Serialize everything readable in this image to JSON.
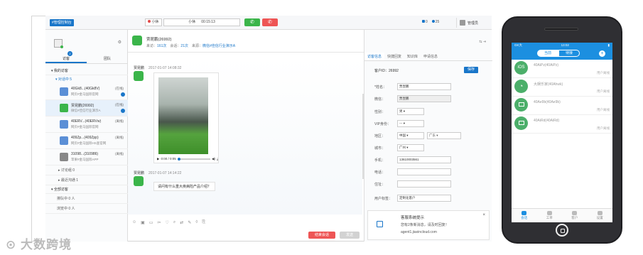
{
  "topbar": {
    "brand": "#管理控制台",
    "status": "小休",
    "status_text": "小休",
    "timer": "00:15:13",
    "msg_count": "0",
    "chat_count": "25",
    "user": "管理员"
  },
  "left": {
    "tabs": [
      {
        "label": "访客",
        "badge": "2"
      },
      {
        "label": "团队"
      }
    ],
    "my_visitors": "我的访客",
    "talking": "对话中 5",
    "visitors": [
      {
        "name": "40Gk8...(40Gk8V)",
        "source": "网页#金马国际官网",
        "status": "(在线)",
        "color": "#5b8fd6"
      },
      {
        "name": "贾昆鹏(26992)",
        "source": "微信#佳信行业演示A",
        "status": "(在线)",
        "color": "#3bb54a"
      },
      {
        "name": "40ERV...(40ERVw)",
        "source": "网页#金马国际官网",
        "status": "(离线)",
        "color": "#5b8fd6"
      },
      {
        "name": "409Zp...(409Zpp)",
        "source": "网页#金马国际HS查官网",
        "status": "(离线)",
        "color": "#5b8fd6"
      },
      {
        "name": "31098...(310986)",
        "source": "苹果#金马国际APP",
        "status": "(离线)",
        "color": "#888888"
      }
    ],
    "discussion": "讨论组 0",
    "recent": "最近沟通 1",
    "all_visitors": "全部访客",
    "queued": "排队中 0 人",
    "browsing": "浏览中 0 人"
  },
  "chat": {
    "name": "贾昆鹏(26992)",
    "visits_label": "来访：",
    "visits": "161次",
    "sessions_label": "会话：",
    "sessions": "21次",
    "source_label": "来源：",
    "source": "微信#佳信行业演示A",
    "m1_name": "贾昆鹏",
    "m1_time": "2017-01-07 14:08:32",
    "video_time": "0:00 / 0:05",
    "m2_name": "贾昆鹏",
    "m2_time": "2017-01-07 14:14:22",
    "m2_text": "请问有什么重大疾病险产品介绍？",
    "end_label": "结束会话",
    "send_label": "发送"
  },
  "right": {
    "tabs": [
      "访客信息",
      "快捷回复",
      "知识库",
      "申请信息"
    ],
    "id_label": "客户ID：",
    "id": "26992",
    "save": "保存",
    "fields": [
      {
        "label": "*姓名：",
        "value": "贾昆鹏"
      },
      {
        "label": "微信：",
        "value": "贾昆鹏"
      },
      {
        "label": "性别：",
        "value": "男"
      },
      {
        "label": "VIP身份：",
        "value": "---"
      },
      {
        "label": "地区：",
        "value": "中国",
        "value2": "广东"
      },
      {
        "label": "城市：",
        "value": "广州"
      },
      {
        "label": "手机：",
        "value": "13610003561"
      },
      {
        "label": "电话：",
        "value": ""
      },
      {
        "label": "住址：",
        "value": ""
      },
      {
        "label": "用户标签：",
        "value": "定制化客户"
      }
    ],
    "notice_title": "客服系统提示",
    "notice_msg": "您有2条新消息，请及时回复！",
    "notice_site": "agent1.jiaxincloud.com"
  },
  "watermark": "大数跨境",
  "phone": {
    "carrier": "GK大",
    "time": "13:02",
    "tab_on": "当前",
    "tab_off": "待接",
    "items": [
      {
        "name": "40AiPz(40AiPz)",
        "status": "用户离线",
        "icon": "iOS"
      },
      {
        "name": "大娱乐家(40Ahwk)",
        "status": "用户离线",
        "icon": "wechat"
      },
      {
        "name": "40Ae9b(40Ae9b)",
        "status": "用户离线",
        "icon": "web"
      },
      {
        "name": "40AiRd(40AiRd)",
        "status": "用户离线",
        "icon": "web"
      }
    ],
    "nav": [
      "会话",
      "工单",
      "客户",
      "设置"
    ]
  }
}
